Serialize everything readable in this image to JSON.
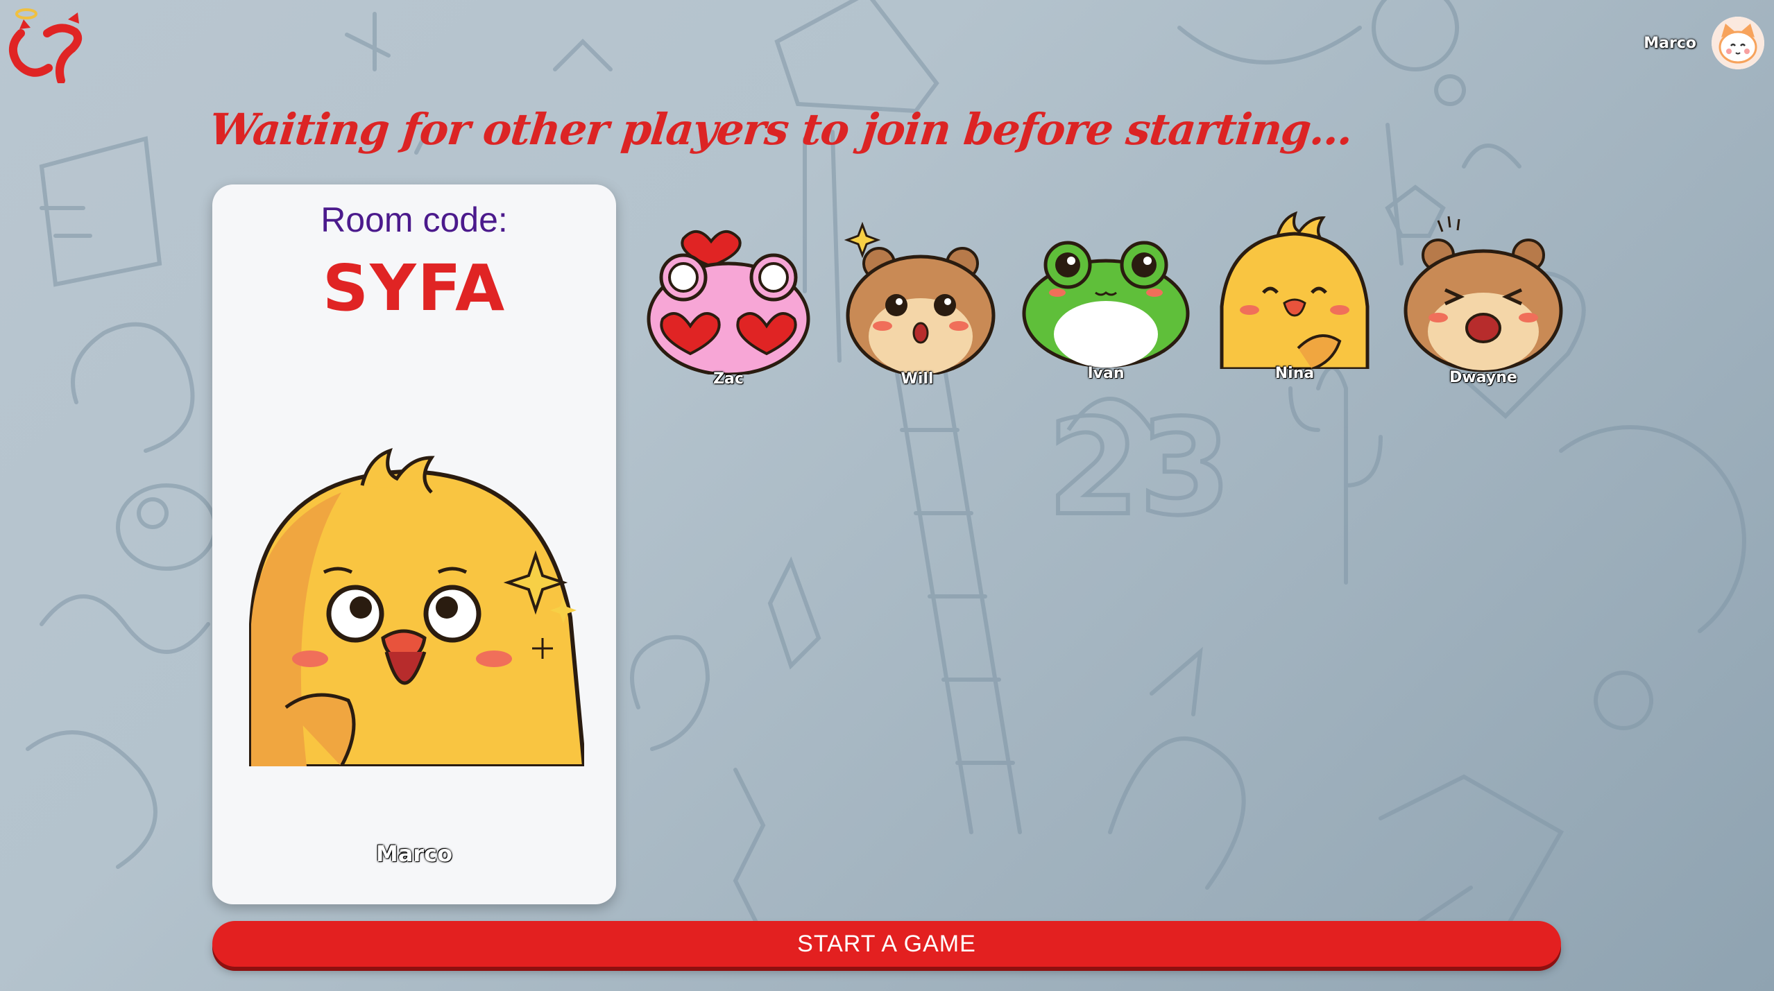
{
  "header": {
    "logo_icon": "app-logo-icon",
    "user": {
      "name": "Marco",
      "avatar_icon": "cat-avatar-icon"
    }
  },
  "lobby": {
    "headline": "Waiting for other players to join before starting...",
    "room_label": "Room code:",
    "room_code": "SYFA",
    "host": {
      "name": "Marco",
      "avatar_icon": "chick-avatar-icon"
    }
  },
  "players": [
    {
      "name": "Zac",
      "avatar_icon": "pink-frog-avatar-icon"
    },
    {
      "name": "Will",
      "avatar_icon": "hamster-avatar-icon"
    },
    {
      "name": "Ivan",
      "avatar_icon": "green-frog-avatar-icon"
    },
    {
      "name": "Nina",
      "avatar_icon": "chick-avatar-icon"
    },
    {
      "name": "Dwayne",
      "avatar_icon": "hamster-avatar-icon"
    }
  ],
  "actions": {
    "start_label": "START A GAME"
  },
  "colors": {
    "accent": "#e32020",
    "room_label": "#4b1a8c",
    "headline": "#dc2424"
  }
}
